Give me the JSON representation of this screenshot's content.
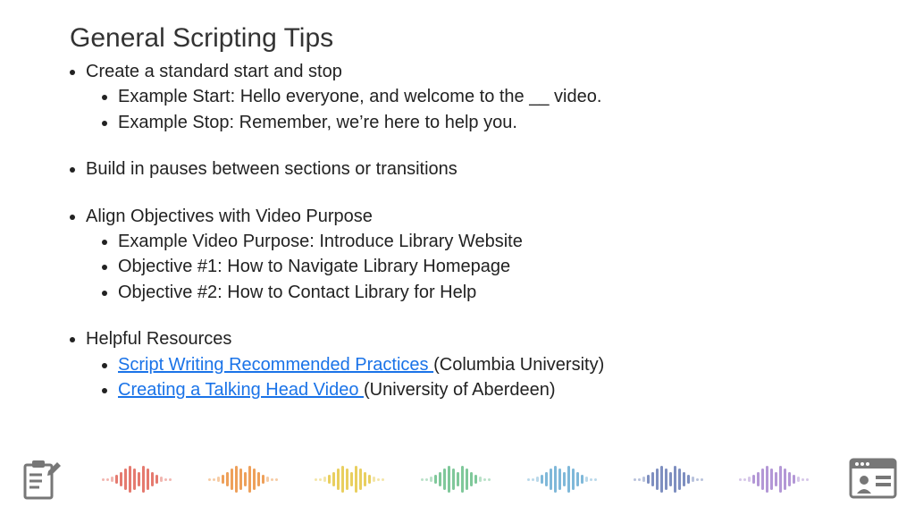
{
  "title": "General Scripting Tips",
  "bullets": {
    "b1": "Create a standard start and stop",
    "b1a": "Example Start: Hello everyone, and welcome to the __ video.",
    "b1b": "Example Stop: Remember, we’re here to help you.",
    "b2": "Build in pauses between sections or transitions",
    "b3": "Align Objectives with Video Purpose",
    "b3a": "Example Video Purpose: Introduce Library Website",
    "b3b": "Objective #1: How to Navigate Library Homepage",
    "b3c": "Objective #2: How to Contact Library for Help",
    "b4": "Helpful Resources",
    "b4a_link": "Script Writing Recommended Practices ",
    "b4a_paren": "(Columbia University)",
    "b4b_link": "Creating a Talking Head Video ",
    "b4b_paren": "(University of Aberdeen)"
  },
  "wave_colors": [
    "#e57a6f",
    "#eea05a",
    "#e9cf5f",
    "#7fc89a",
    "#7fb8d9",
    "#7e8fc0",
    "#b397d6"
  ]
}
